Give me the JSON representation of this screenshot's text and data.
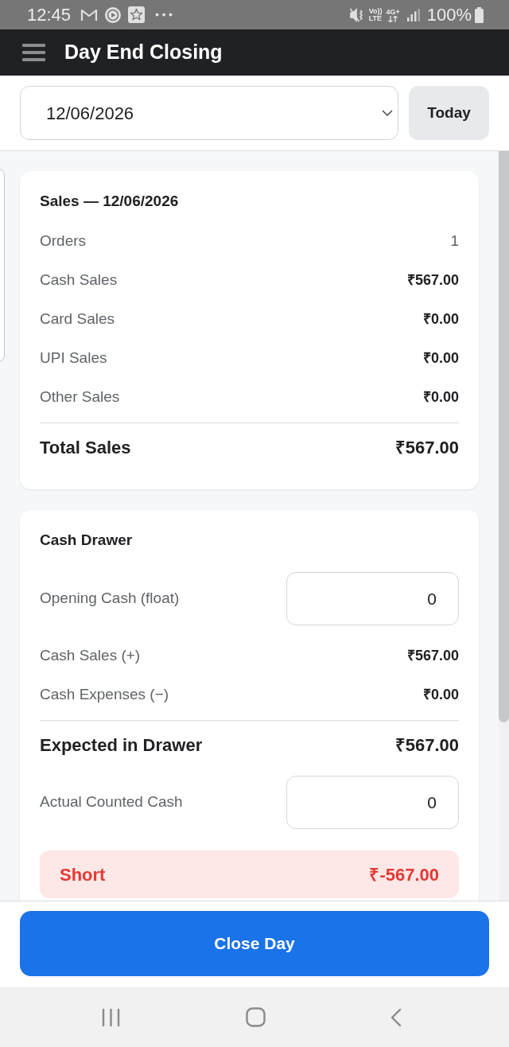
{
  "status_bar": {
    "time": "12:45",
    "volte": [
      "Vo))",
      "LTE"
    ],
    "network": "4G+",
    "battery": "100%"
  },
  "app_bar": {
    "title": "Day End Closing"
  },
  "date_filter": {
    "value": "12/06/2026",
    "today_button": "Today"
  },
  "sales_card": {
    "title": "Sales — 12/06/2026",
    "rows": [
      {
        "kind": "count",
        "label": "Orders",
        "value": "1"
      },
      {
        "kind": "amount",
        "label": "Cash Sales",
        "value": "₹567.00"
      },
      {
        "kind": "amount",
        "label": "Card Sales",
        "value": "₹0.00"
      },
      {
        "kind": "amount",
        "label": "UPI Sales",
        "value": "₹0.00"
      },
      {
        "kind": "amount",
        "label": "Other Sales",
        "value": "₹0.00"
      },
      {
        "kind": "total",
        "label": "Total Sales",
        "value": "₹567.00"
      }
    ]
  },
  "cash_drawer": {
    "title": "Cash Drawer",
    "rows": [
      {
        "kind": "input",
        "label": "Opening Cash (float)",
        "value": "0"
      },
      {
        "kind": "amount",
        "label": "Cash Sales (+)",
        "value": "₹567.00"
      },
      {
        "kind": "amount",
        "label": "Cash Expenses (−)",
        "value": "₹0.00"
      },
      {
        "kind": "total",
        "label": "Expected in Drawer",
        "value": "₹567.00"
      },
      {
        "kind": "input",
        "label": "Actual Counted Cash",
        "value": "0"
      }
    ],
    "variance": {
      "kind": "short",
      "label": "Short",
      "amount": "₹-567.00"
    }
  },
  "footer": {
    "button": "Close Day"
  }
}
